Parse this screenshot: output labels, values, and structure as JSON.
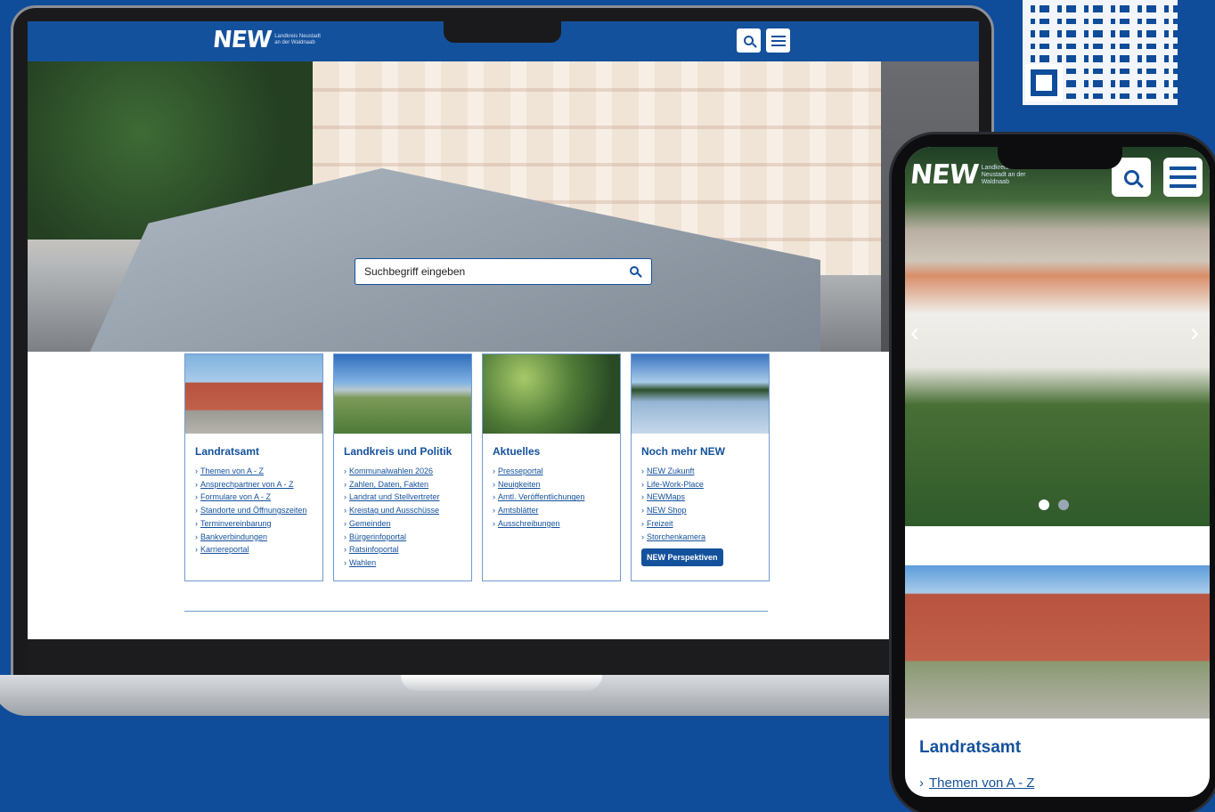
{
  "brand": {
    "logo_word": "NEW",
    "logo_text": "Landkreis Neustadt an der Waldnaab",
    "primary_color": "#14519c",
    "background_color": "#0f4c9a"
  },
  "desktop": {
    "search": {
      "placeholder": "Suchbegriff eingeben"
    },
    "cards": [
      {
        "title": "Landratsamt",
        "links": [
          "Themen von A - Z",
          "Ansprechpartner von A - Z",
          "Formulare von A - Z",
          "Standorte und Öffnungszeiten",
          "Terminvereinbarung",
          "Bankverbindungen",
          "Karriereportal"
        ]
      },
      {
        "title": "Landkreis und Politik",
        "links": [
          "Kommunalwahlen 2026",
          "Zahlen, Daten, Fakten",
          "Landrat und Stellvertreter",
          "Kreistag und Ausschüsse",
          "Gemeinden",
          "Bürgerinfoportal",
          "Ratsinfoportal",
          "Wahlen"
        ]
      },
      {
        "title": "Aktuelles",
        "links": [
          "Presseportal",
          "Neuigkeiten",
          "Amtl. Veröffentlichungen",
          "Amtsblätter",
          "Ausschreibungen"
        ]
      },
      {
        "title": "Noch mehr NEW",
        "links": [
          "NEW Zukunft",
          "Life-Work-Place",
          "NEWMaps",
          "NEW Shop",
          "Freizeit",
          "Storchenkamera"
        ],
        "button": "NEW Perspektiven"
      }
    ]
  },
  "mobile": {
    "arrow_left": "‹",
    "arrow_right": "›",
    "card_title": "Landratsamt",
    "card_link": "Themen von A - Z"
  }
}
